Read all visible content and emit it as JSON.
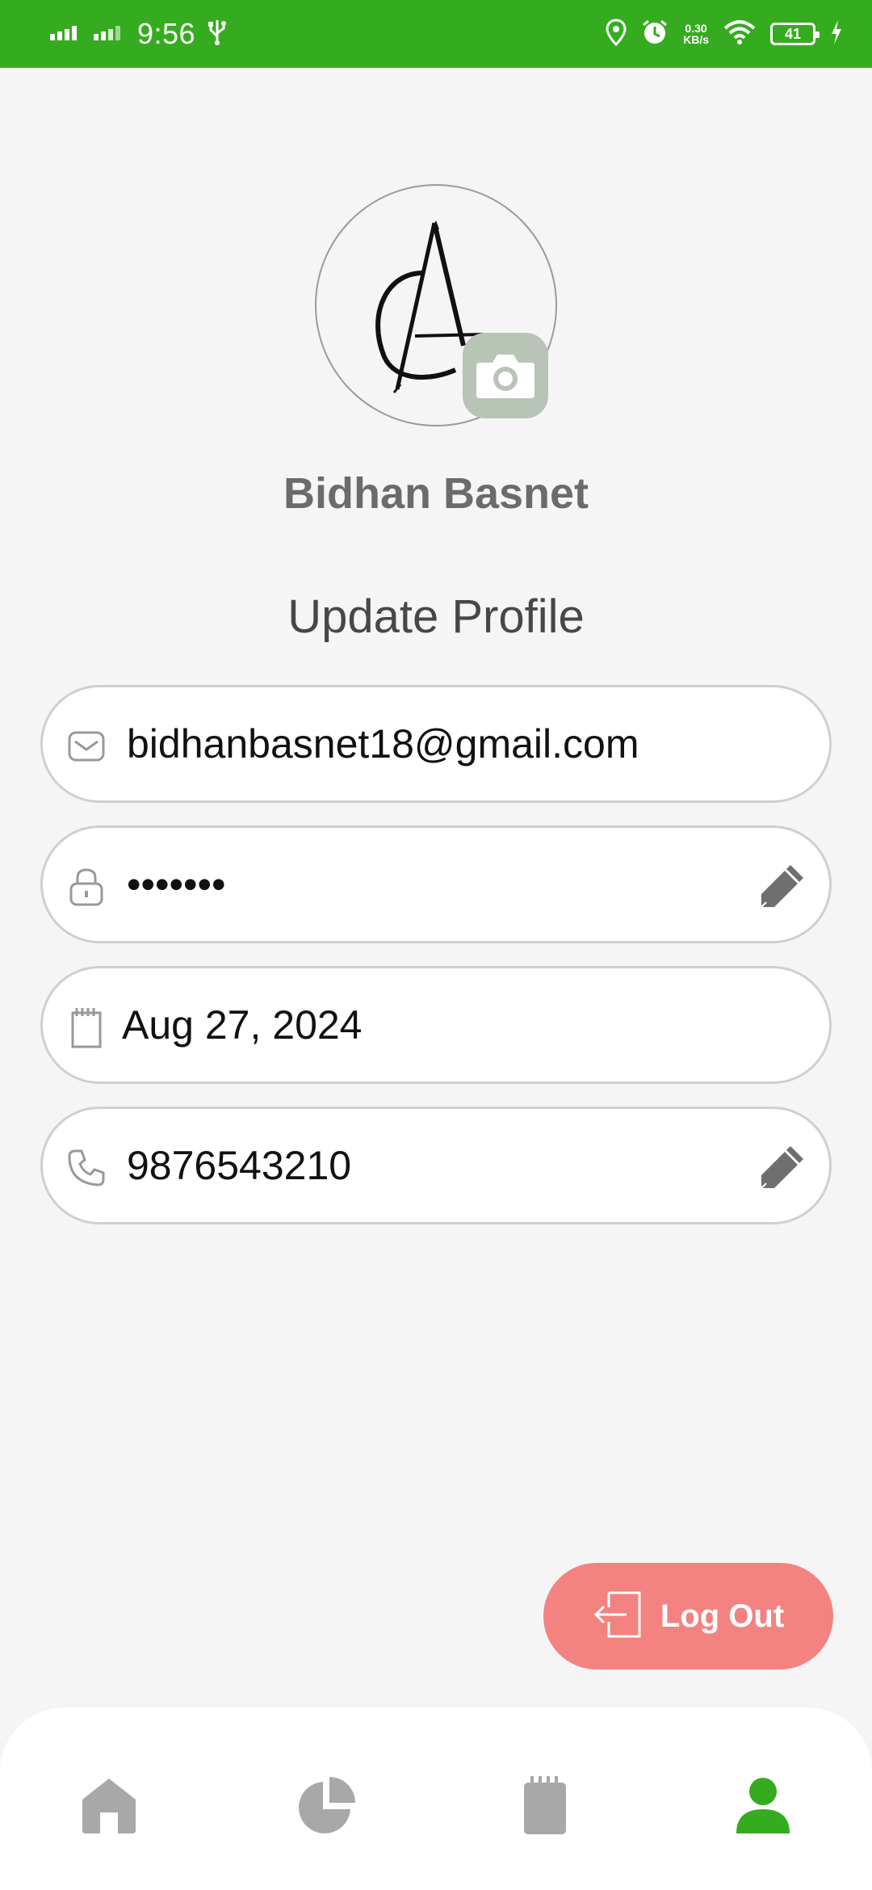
{
  "status_bar": {
    "time": "9:56",
    "speed_value": "0.30",
    "speed_unit": "KB/s",
    "battery": "41",
    "icons": [
      "signal-icon",
      "signal-icon",
      "usb-icon",
      "location-icon",
      "alarm-icon",
      "wifi-icon",
      "battery-icon",
      "charging-icon"
    ]
  },
  "profile": {
    "name": "Bidhan Basnet",
    "section_title": "Update Profile"
  },
  "fields": {
    "email": {
      "value": "bidhanbasnet18@gmail.com",
      "icon": "mail-icon"
    },
    "password": {
      "value": "•••••••",
      "icon": "lock-icon",
      "editable": true
    },
    "date": {
      "value": "Aug 27, 2024",
      "icon": "calendar-icon"
    },
    "phone": {
      "value": "9876543210",
      "icon": "phone-icon",
      "editable": true
    }
  },
  "logout": {
    "label": "Log Out",
    "icon": "logout-icon"
  },
  "nav": {
    "items": [
      {
        "name": "home",
        "icon": "home-icon",
        "active": false
      },
      {
        "name": "stats",
        "icon": "pie-chart-icon",
        "active": false
      },
      {
        "name": "notes",
        "icon": "notepad-icon",
        "active": false
      },
      {
        "name": "profile",
        "icon": "person-icon",
        "active": true
      }
    ]
  },
  "colors": {
    "primary": "#35ac1f",
    "logout": "#f38281",
    "camera_button": "#b7c4b6",
    "nav_inactive": "#a8a8a8"
  }
}
